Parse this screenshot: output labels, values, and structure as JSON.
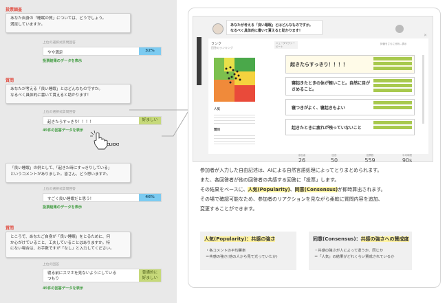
{
  "left": {
    "sections": [
      {
        "title": "投票調査",
        "question_lines": [
          "あなた自身の「睡眠の質」については、どうでしょう。",
          "満足していますか。"
        ],
        "sub": "上位の選択式質問回答",
        "answer": "やや満足",
        "result_value": "32%",
        "link": "投票結果のデータを表示"
      },
      {
        "title": "質問",
        "question_lines": [
          "あなたが考える「良い睡眠」とはどんなものですか。",
          "なるべく具体的に書いて貰えると助かります！"
        ],
        "sub": "上位の選択式質問回答",
        "answer": "起きたらすっきり！！！！",
        "result_value": "好ましい",
        "link": "45件の回答データを表示"
      },
      {
        "title": "",
        "question_lines": [
          "「良い睡眠」の例として、「起きた時にすっきりしている」",
          "というコメントがありました。皆さん、どう思いますか。"
        ],
        "sub": "上位の選択式質問回答",
        "answer": "すごく良い睡眠だと思う！",
        "result_value": "46%",
        "link": "投票結果のデータを表示"
      },
      {
        "title": "質問",
        "question_lines": [
          "ところで、あなたご自身が「良い睡眠」をとるために、何",
          "か心がけていること、工夫していることはありますか。特",
          "にない場合は、お手数ですが「なし」と入力してください。"
        ],
        "sub": "上位の回答",
        "answer_lines": [
          "寝る前にスマホを見ないようにしている",
          "つもり"
        ],
        "result_lines": [
          "普通的に",
          "好ましい"
        ],
        "link": "45件の回答データを表示"
      }
    ],
    "click_label": "CLICK!"
  },
  "screen": {
    "bubble_lines": [
      "あなたが考える「良い睡眠」とはどんなものですか。",
      "なるべく具体的に書いて貰えると助かります！"
    ],
    "rank_title": "ランク",
    "rank_sub": "回答のランキング",
    "chip": "ニューダマクシー ビート",
    "sort_label": "評価をさらに分析...表示",
    "side_heading": "人気",
    "side_heading2": "賛同",
    "answers": [
      "起きたらすっきり！！！！",
      "寝起きたときの体が軽いこと。自然に目がさめること。",
      "寝つきがよく、寝起きもよい",
      "起きたときに疲れが残っていないこと"
    ],
    "stats": [
      {
        "value": "26",
        "label": "参加者"
      },
      {
        "value": "50",
        "label": "回答"
      },
      {
        "value": "559",
        "label": "投票数"
      },
      {
        "value": "90s",
        "label": "平均時間"
      }
    ]
  },
  "description_lines": [
    "参加者が入力した自由記述は、AIによる自然言語処理によってとりまとめられます。",
    "また、各回答者が他の回答者の共感する回答に「投票」します。",
    "その結果をベースに、",
    "人気(Popularity)",
    "、",
    "同意(Consensus)",
    "が即時算出されます。",
    "その場で確認可能なため、参加者のリアクションを見ながら柔軟に質問内容を追加、",
    "変更することができます。"
  ],
  "boxes": [
    {
      "title": "人気(Popularity)：共感の強さ",
      "lines": [
        "・各コメントの平均勝率",
        "＝共感の強さ(他の人から見て光っていたか)"
      ]
    },
    {
      "title_a": "同意(Consensus)：",
      "title_b": "共感の強さへの賛成度",
      "lines": [
        "・共感の強さが人によって違うか、同じか",
        "＝「人気」の結果がどれくらい賛成されているか"
      ]
    }
  ]
}
